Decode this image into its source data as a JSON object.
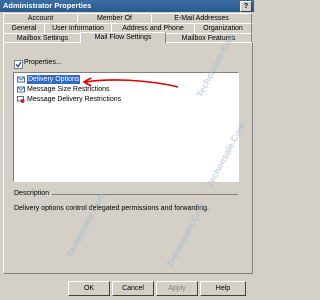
{
  "window": {
    "title": "Administrator Properties",
    "help_glyph": "?"
  },
  "tabs_row1": [
    "Account",
    "Member Of",
    "E-Mail Addresses"
  ],
  "tabs_row2": [
    "General",
    "User Information",
    "Address and Phone",
    "Organization"
  ],
  "tabs_row3": [
    "Mailbox Settings",
    "Mail Flow Settings",
    "Mailbox Features"
  ],
  "active_tab": "Mail Flow Settings",
  "toolbar": {
    "properties_label": "Properties...",
    "properties_checked": true
  },
  "settings_list": [
    {
      "label": "Delivery Options",
      "selected": true
    },
    {
      "label": "Message Size Restrictions",
      "selected": false
    },
    {
      "label": "Message Delivery Restrictions",
      "selected": false
    }
  ],
  "description": {
    "heading": "Description",
    "text": "Delivery options control delegated permissions and forwarding."
  },
  "buttons": {
    "ok": "OK",
    "cancel": "Cancel",
    "apply": "Apply",
    "help": "Help"
  },
  "watermark": "Techonsale.Com",
  "colors": {
    "selection": "#316ac5",
    "annotation_arrow": "#e00000",
    "titlebar": "#2b5a8c"
  }
}
